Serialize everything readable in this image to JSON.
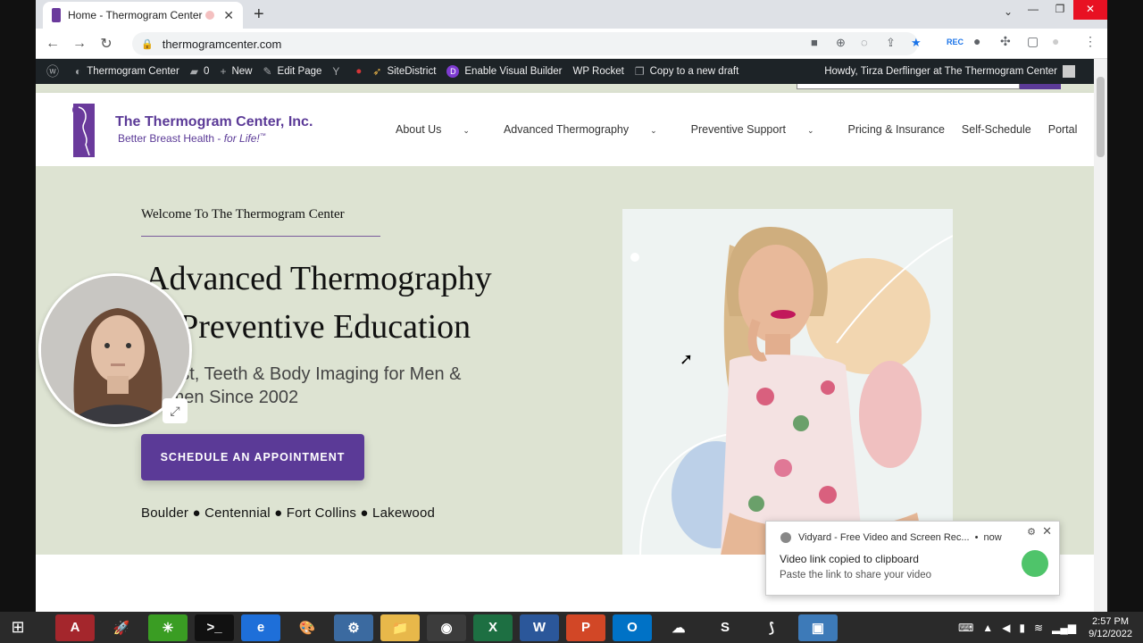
{
  "browser": {
    "tab_title": "Home - Thermogram Center",
    "new_tab": "+",
    "tab_close": "✕",
    "url": "thermogramcenter.com",
    "window_controls": [
      "—",
      "❐",
      "✕"
    ],
    "tab_menu": "⌄",
    "nav": {
      "back": "←",
      "forward": "→",
      "reload": "↻"
    },
    "rec_label": "REC"
  },
  "wp_admin": {
    "site_name": "Thermogram Center",
    "comments_count": "0",
    "new_label": "New",
    "edit_label": "Edit Page",
    "sitedistrict": "SiteDistrict",
    "visual_builder": "Enable Visual Builder",
    "wp_rocket": "WP Rocket",
    "copy_draft": "Copy to a new draft",
    "howdy": "Howdy, Tirza Derflinger at The Thermogram Center"
  },
  "site": {
    "logo_name": "The Thermogram Center, Inc.",
    "logo_tag_main": "Better Breast Health - ",
    "logo_tag_em": "for Life!",
    "logo_tm": "™",
    "nav": [
      {
        "label": "About Us",
        "has_menu": true
      },
      {
        "label": "Advanced Thermography",
        "has_menu": true
      },
      {
        "label": "Preventive Support",
        "has_menu": true
      },
      {
        "label": "Pricing & Insurance",
        "has_menu": false
      },
      {
        "label": "Self-Schedule",
        "has_menu": false
      },
      {
        "label": "Portal",
        "has_menu": false
      }
    ],
    "hero": {
      "welcome": "Welcome To The Thermogram Center",
      "headline_1": "Advanced Thermography",
      "headline_2": "Preventive Education",
      "headline_2_prefix": "&",
      "sub_1": "Breast, Teeth & Body Imaging for Men &",
      "sub_2": "Women Since 2002",
      "cta": "SCHEDULE AN APPOINTMENT",
      "locations": "Boulder ● Centennial ● Fort Collins ● Lakewood"
    }
  },
  "notification": {
    "app": "Vidyard - Free Video and Screen Rec...",
    "time": "now",
    "message": "Video link copied to clipboard",
    "detail": "Paste the link to share your video"
  },
  "taskbar": {
    "apps": [
      {
        "name": "access",
        "label": "A",
        "color": "#a4262c"
      },
      {
        "name": "rocket",
        "label": "🚀",
        "color": "#2a2a2a"
      },
      {
        "name": "green-app",
        "label": "✳",
        "color": "#3a9d23"
      },
      {
        "name": "terminal",
        "label": ">_",
        "color": "#111111"
      },
      {
        "name": "ie",
        "label": "e",
        "color": "#1e6fd9"
      },
      {
        "name": "paint",
        "label": "🎨",
        "color": "#2a2a2a"
      },
      {
        "name": "control",
        "label": "⚙",
        "color": "#3b6aa0"
      },
      {
        "name": "explorer",
        "label": "📁",
        "color": "#e8b84a"
      },
      {
        "name": "chrome",
        "label": "◉",
        "color": "#3c3c3c"
      },
      {
        "name": "excel",
        "label": "X",
        "color": "#1d6f42"
      },
      {
        "name": "word",
        "label": "W",
        "color": "#2b579a"
      },
      {
        "name": "powerpoint",
        "label": "P",
        "color": "#d24726"
      },
      {
        "name": "outlook",
        "label": "O",
        "color": "#0072c6"
      },
      {
        "name": "lotus",
        "label": "☁",
        "color": "#2a2a2a"
      },
      {
        "name": "s-app",
        "label": "S",
        "color": "#2a2a2a"
      },
      {
        "name": "acrobat",
        "label": "⟆",
        "color": "#2a2a2a"
      },
      {
        "name": "photos",
        "label": "▣",
        "color": "#3d7ab8"
      }
    ],
    "time": "2:57 PM",
    "date": "9/12/2022"
  }
}
